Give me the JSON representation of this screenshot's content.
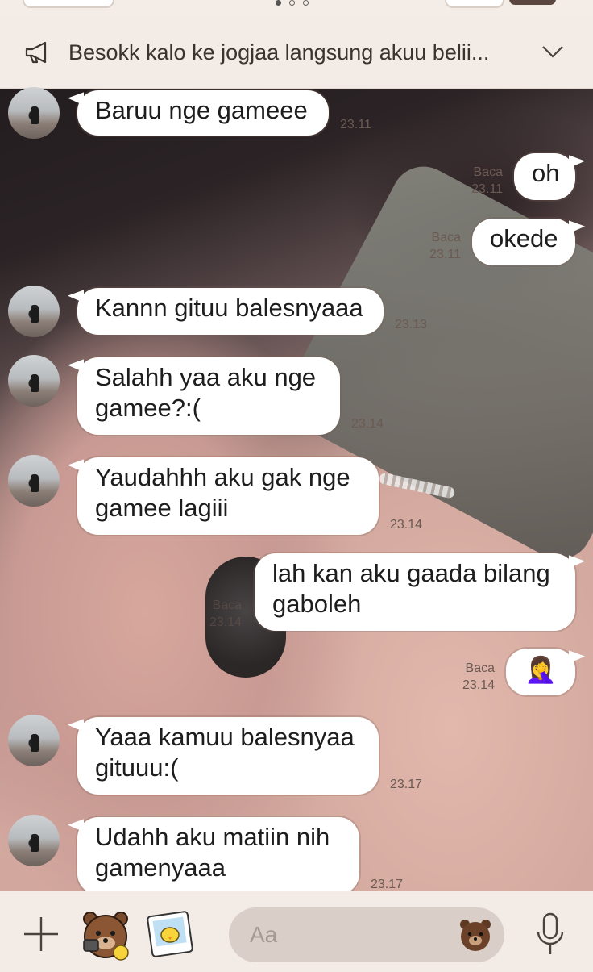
{
  "pager": {
    "dots": 3,
    "active_index": 0
  },
  "announcement": {
    "icon": "megaphone-icon",
    "text": "Besokk kalo ke jogjaa langsung akuu belii...",
    "expand_icon": "chevron-down-icon"
  },
  "messages": [
    {
      "side": "in",
      "lines": [
        "Baruu nge gameee"
      ],
      "time": "23.11"
    },
    {
      "side": "out",
      "lines": [
        "oh"
      ],
      "read": "Baca",
      "time": "23.11"
    },
    {
      "side": "out",
      "lines": [
        "okede"
      ],
      "read": "Baca",
      "time": "23.11"
    },
    {
      "side": "in",
      "lines": [
        "Kannn gituu balesnyaaa"
      ],
      "time": "23.13"
    },
    {
      "side": "in",
      "lines": [
        "Salahh yaa aku nge",
        "gamee?:("
      ],
      "time": "23.14"
    },
    {
      "side": "in",
      "lines": [
        "Yaudahhh aku gak nge",
        "gamee lagiii"
      ],
      "time": "23.14"
    },
    {
      "side": "out",
      "lines": [
        "lah kan aku gaada bilang",
        "gaboleh"
      ],
      "read": "Baca",
      "time": "23.14"
    },
    {
      "side": "out",
      "lines": [
        "🤦‍♀️"
      ],
      "read": "Baca",
      "time": "23.14"
    },
    {
      "side": "in",
      "lines": [
        "Yaaa kamuu balesnyaa",
        "gituuu:("
      ],
      "time": "23.17"
    },
    {
      "side": "in",
      "lines": [
        "Udahh aku matiin nih",
        "gamenyaaa"
      ],
      "time": "23.17"
    }
  ],
  "composer": {
    "placeholder": "Aa",
    "plus_icon": "plus-icon",
    "sticker_icon": "bear-sticker-icon",
    "photo_icon": "photo-sticker-icon",
    "emoji_icon": "bear-emoji-icon",
    "mic_icon": "microphone-icon"
  },
  "colors": {
    "bubble": "#ffffff",
    "banner": "#f3ebe5",
    "input": "#d9cfc8",
    "meta": "#6b5a52"
  }
}
